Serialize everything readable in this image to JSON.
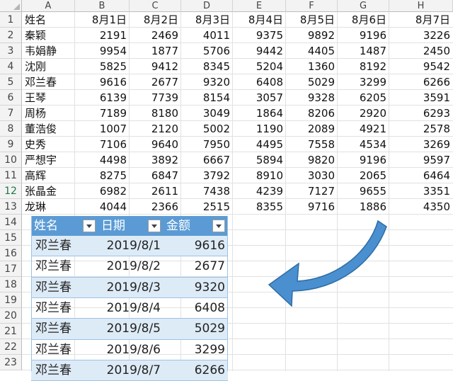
{
  "columns": [
    "A",
    "B",
    "C",
    "D",
    "E",
    "F",
    "G",
    "H"
  ],
  "rows": [
    "1",
    "2",
    "3",
    "4",
    "5",
    "6",
    "7",
    "8",
    "9",
    "10",
    "11",
    "12",
    "13",
    "14",
    "15",
    "16",
    "17",
    "18",
    "19",
    "20",
    "21",
    "22",
    "23"
  ],
  "header_row": [
    "姓名",
    "8月1日",
    "8月2日",
    "8月3日",
    "8月4日",
    "8月5日",
    "8月6日",
    "8月7日"
  ],
  "data_rows": [
    [
      "秦颖",
      "2191",
      "2469",
      "4011",
      "9375",
      "9892",
      "9196",
      "3226"
    ],
    [
      "韦娟静",
      "9954",
      "1877",
      "5706",
      "9442",
      "4405",
      "1487",
      "2450"
    ],
    [
      "沈刚",
      "5825",
      "9412",
      "8345",
      "5204",
      "1360",
      "8192",
      "9542"
    ],
    [
      "邓兰春",
      "9616",
      "2677",
      "9320",
      "6408",
      "5029",
      "3299",
      "6266"
    ],
    [
      "王琴",
      "6139",
      "7739",
      "8154",
      "3057",
      "9328",
      "6205",
      "3591"
    ],
    [
      "周杨",
      "7189",
      "8180",
      "3049",
      "1864",
      "8206",
      "2920",
      "6293"
    ],
    [
      "董浩俊",
      "1007",
      "2120",
      "5002",
      "1190",
      "2089",
      "4921",
      "2578"
    ],
    [
      "史秀",
      "7106",
      "9640",
      "7950",
      "4495",
      "7558",
      "4534",
      "3269"
    ],
    [
      "严想宇",
      "4498",
      "3892",
      "6667",
      "5894",
      "9820",
      "9196",
      "9597"
    ],
    [
      "高辉",
      "8275",
      "6847",
      "3792",
      "8910",
      "3030",
      "2065",
      "6464"
    ],
    [
      "张晶金",
      "6982",
      "2611",
      "7438",
      "4239",
      "7127",
      "9655",
      "3351"
    ],
    [
      "龙琳",
      "4044",
      "2366",
      "2515",
      "8355",
      "9716",
      "1886",
      "4350"
    ]
  ],
  "table": {
    "headers": [
      "姓名",
      "日期",
      "金额"
    ],
    "rows": [
      [
        "邓兰春",
        "2019/8/1",
        "9616"
      ],
      [
        "邓兰春",
        "2019/8/2",
        "2677"
      ],
      [
        "邓兰春",
        "2019/8/3",
        "9320"
      ],
      [
        "邓兰春",
        "2019/8/4",
        "6408"
      ],
      [
        "邓兰春",
        "2019/8/5",
        "5029"
      ],
      [
        "邓兰春",
        "2019/8/6",
        "3299"
      ],
      [
        "邓兰春",
        "2019/8/7",
        "6266"
      ]
    ]
  },
  "colors": {
    "table_header": "#5b9bd5",
    "table_band": "#ddebf7",
    "arrow_fill": "#4a8fd0",
    "arrow_stroke": "#2e6da4",
    "selected_row_header": "#217346"
  }
}
